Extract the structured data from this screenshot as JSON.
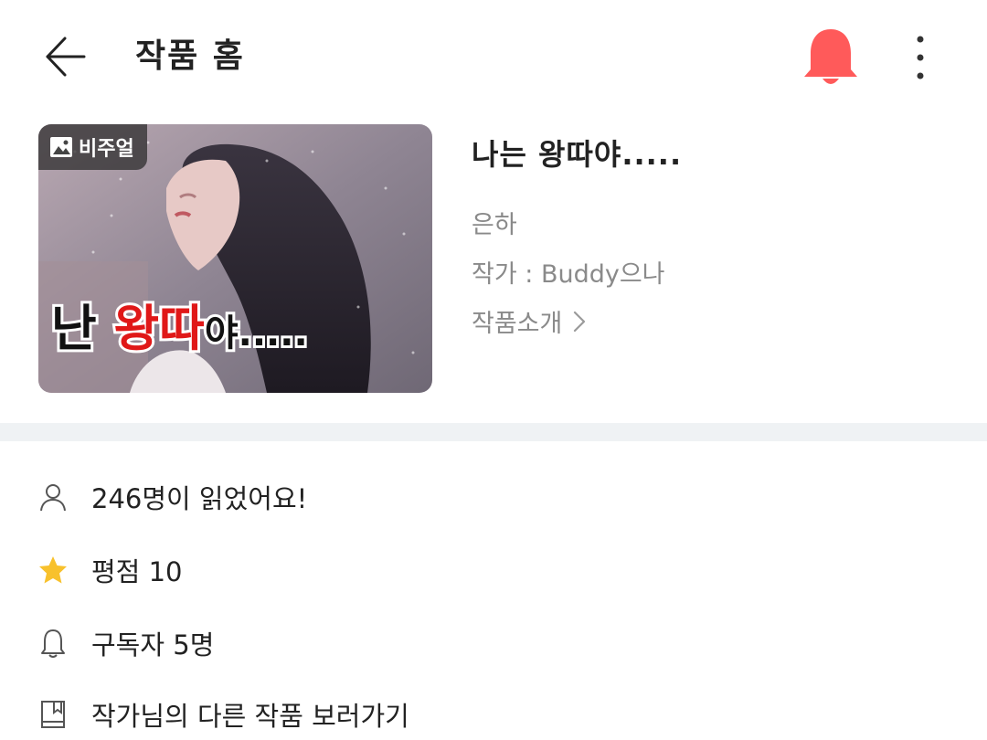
{
  "header": {
    "title": "작품 홈",
    "back_icon": "arrow-left-icon",
    "notify_icon": "bell-icon",
    "notify_color": "#ff5a5a",
    "more_icon": "vertical-dots-icon"
  },
  "work": {
    "badge_label": "비주얼",
    "badge_icon": "image-icon",
    "thumbnail_caption_parts": [
      "난 ",
      "왕따",
      "야....."
    ],
    "title": "나는 왕따야.....",
    "subtitle": "은하",
    "author": "작가 : Buddy으나",
    "intro_label": "작품소개",
    "intro_icon": "chevron-right-icon"
  },
  "stats": {
    "readers": "246명이 읽었어요!",
    "rating": "평점 10",
    "subscribers": "구독자 5명",
    "other_works": "작가님의 다른 작품 보러가기",
    "icons": [
      "person-icon",
      "star-icon",
      "bell-outline-icon",
      "book-icon"
    ],
    "star_color": "#f8c12c"
  }
}
